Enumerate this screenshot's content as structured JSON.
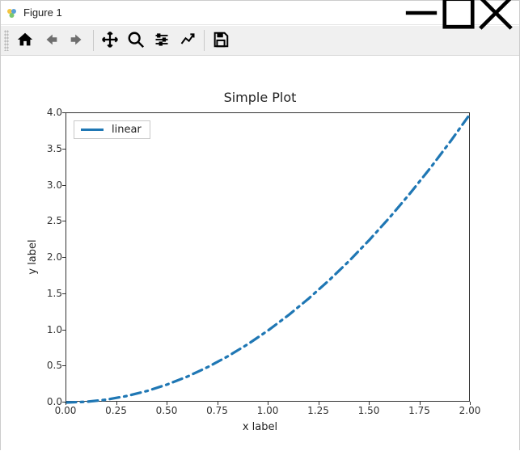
{
  "window": {
    "title": "Figure 1",
    "controls": {
      "minimize": "Minimize",
      "maximize": "Maximize",
      "close": "Close"
    }
  },
  "toolbar": {
    "home": "Home",
    "back": "Back",
    "forward": "Forward",
    "pan": "Pan",
    "zoom": "Zoom",
    "subplots": "Configure subplots",
    "axes": "Edit axis",
    "save": "Save"
  },
  "chart": {
    "title": "Simple Plot",
    "xlabel": "x label",
    "ylabel": "y label",
    "legend_label": "linear",
    "line_color": "#1f77b4",
    "xticks": [
      "0.00",
      "0.25",
      "0.50",
      "0.75",
      "1.00",
      "1.25",
      "1.50",
      "1.75",
      "2.00"
    ],
    "yticks": [
      "0.0",
      "0.5",
      "1.0",
      "1.5",
      "2.0",
      "2.5",
      "3.0",
      "3.5",
      "4.0"
    ]
  },
  "chart_data": {
    "type": "line",
    "title": "Simple Plot",
    "xlabel": "x label",
    "ylabel": "y label",
    "xlim": [
      0.0,
      2.0
    ],
    "ylim": [
      0.0,
      4.0
    ],
    "line_style": "dashdot",
    "series": [
      {
        "name": "linear",
        "x": [
          0.0,
          0.1,
          0.2,
          0.3,
          0.4,
          0.5,
          0.6,
          0.7,
          0.8,
          0.9,
          1.0,
          1.1,
          1.2,
          1.3,
          1.4,
          1.5,
          1.6,
          1.7,
          1.8,
          1.9,
          2.0
        ],
        "y": [
          0.0,
          0.01,
          0.04,
          0.09,
          0.16,
          0.25,
          0.36,
          0.49,
          0.64,
          0.81,
          1.0,
          1.21,
          1.44,
          1.69,
          1.96,
          2.25,
          2.56,
          2.89,
          3.24,
          3.61,
          4.0
        ]
      }
    ],
    "legend": {
      "position": "upper left"
    }
  }
}
